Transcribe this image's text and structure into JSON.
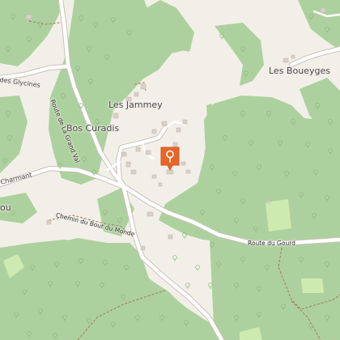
{
  "map": {
    "places": {
      "les_jammey": "Les Jammey",
      "bos_curadis": "Bos Curadis",
      "les_boueyges": "Les Boueyges",
      "des_glycines": "des Glycines",
      "charmant": "Charmant",
      "ou": "ou"
    },
    "roads": {
      "route_grand_val": "Route de La Grand Val",
      "chemin_bout_du_monde": "Chemin du Bout du Monde",
      "route_du_gourd": "Route du Gourd"
    },
    "marker": {
      "icon": "location-pin-icon",
      "color": "#e8662a"
    },
    "colors": {
      "background": "#f2efe9",
      "forest": "#add19e",
      "meadow": "#cdebb0",
      "road": "#ffffff",
      "road_casing": "#c9c2b8",
      "track": "#a0825a",
      "building": "#d9d0c9"
    }
  }
}
